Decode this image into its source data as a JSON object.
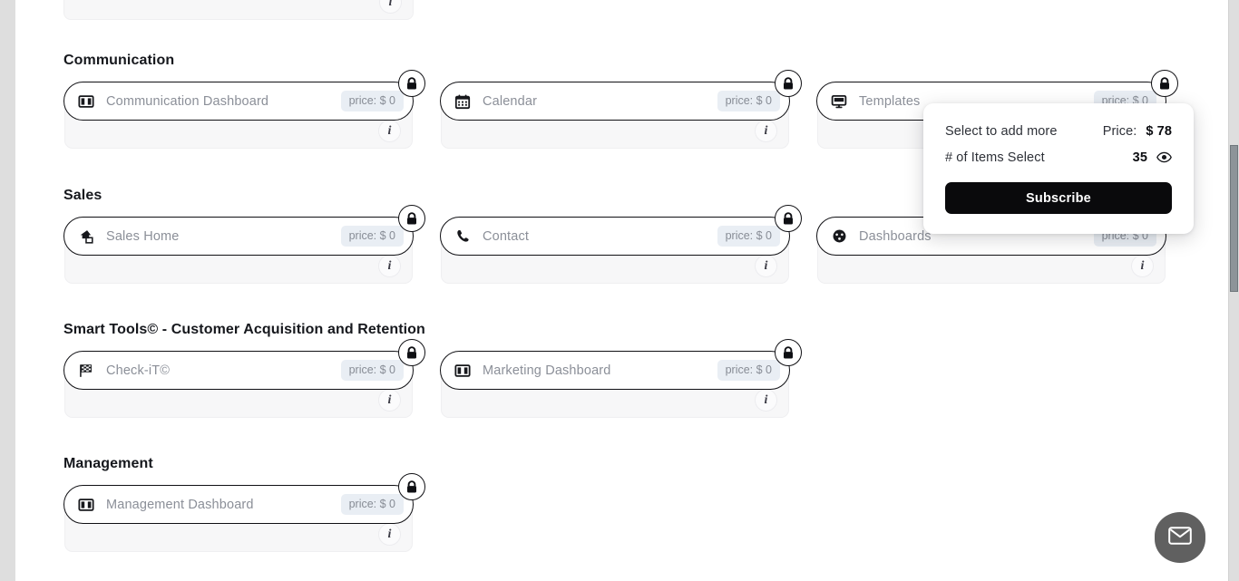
{
  "page": {
    "background_color": "#dedede",
    "surface_color": "#ffffff"
  },
  "sections": [
    {
      "id": "communication",
      "title": "Communication",
      "items": [
        {
          "label": "Communication Dashboard",
          "price": "price: $ 0",
          "icon": "dashboard-panel-icon",
          "locked": true,
          "info": "i"
        },
        {
          "label": "Calendar",
          "price": "price: $ 0",
          "icon": "calendar-icon",
          "locked": true,
          "info": "i"
        },
        {
          "label": "Templates",
          "price": "price: $ 0",
          "icon": "monitor-icon",
          "locked": true,
          "info": "i"
        }
      ]
    },
    {
      "id": "sales",
      "title": "Sales",
      "items": [
        {
          "label": "Sales Home",
          "price": "price: $ 0",
          "icon": "sales-home-icon",
          "locked": true,
          "info": "i"
        },
        {
          "label": "Contact",
          "price": "price: $ 0",
          "icon": "phone-icon",
          "locked": true,
          "info": "i"
        },
        {
          "label": "Dashboards",
          "price": "price: $ 0",
          "icon": "gauge-icon",
          "locked": false,
          "info": "i"
        }
      ]
    },
    {
      "id": "smart-tools",
      "title": "Smart Tools© - Customer Acquisition and Retention",
      "items": [
        {
          "label": "Check-iT©",
          "price": "price: $ 0",
          "icon": "checkered-flag-icon",
          "locked": true,
          "info": "i"
        },
        {
          "label": "Marketing Dashboard",
          "price": "price: $ 0",
          "icon": "dashboard-panel-icon",
          "locked": true,
          "info": "i"
        }
      ]
    },
    {
      "id": "management",
      "title": "Management",
      "items": [
        {
          "label": "Management Dashboard",
          "price": "price: $ 0",
          "icon": "dashboard-panel-icon",
          "locked": true,
          "info": "i"
        }
      ]
    }
  ],
  "partial_card_top": {
    "info": "i"
  },
  "subscribe_popup": {
    "select_more_label": "Select to add more",
    "price_label": "Price:",
    "price_value": "$ 78",
    "items_label": "# of Items Select",
    "items_value": "35",
    "eye_icon": "eye-icon",
    "subscribe_label": "Subscribe"
  },
  "chat_button": {
    "icon": "envelope-icon"
  },
  "scrollbar": {
    "thumb_color": "#8d9499",
    "track_color": "#dedede"
  }
}
